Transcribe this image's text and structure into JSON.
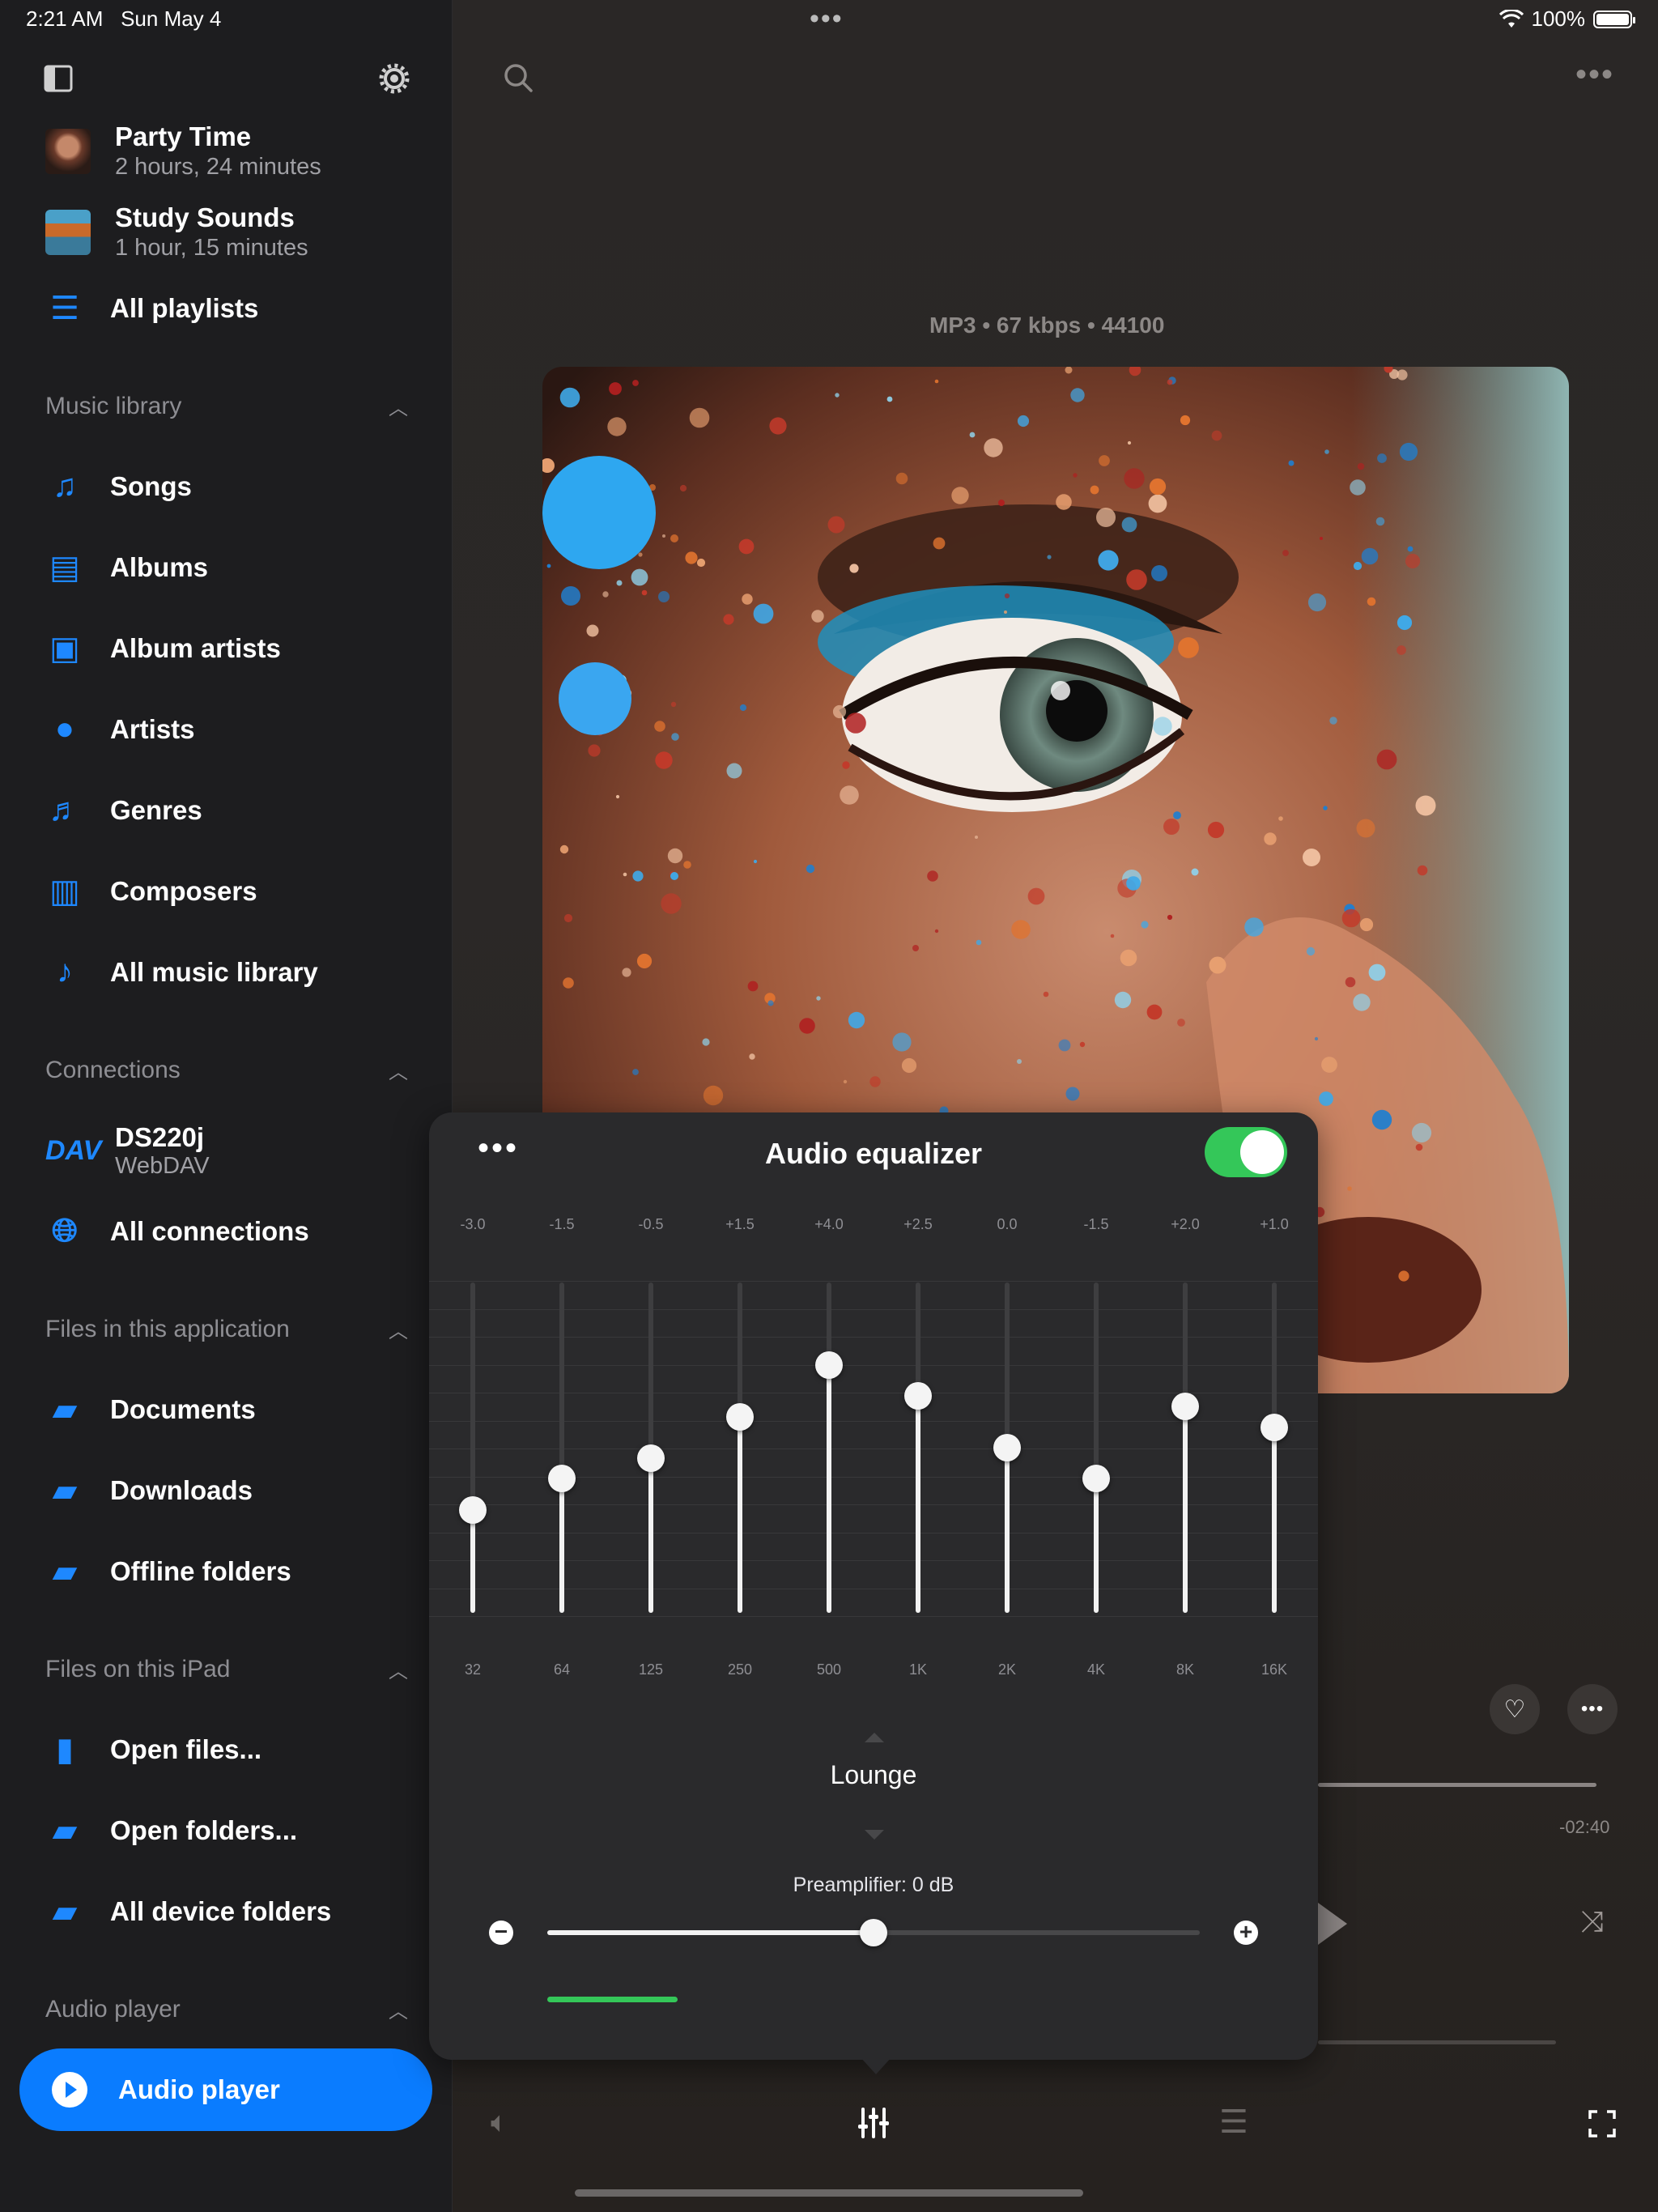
{
  "status_bar": {
    "time": "2:21 AM",
    "date": "Sun May 4",
    "battery": "100%"
  },
  "sidebar": {
    "playlists": [
      {
        "title": "Party Time",
        "subtitle": "2 hours, 24 minutes"
      },
      {
        "title": "Study Sounds",
        "subtitle": "1 hour, 15 minutes"
      }
    ],
    "all_playlists": "All playlists",
    "music_library": {
      "heading": "Music library",
      "items": [
        "Songs",
        "Albums",
        "Album artists",
        "Artists",
        "Genres",
        "Composers",
        "All music library"
      ]
    },
    "connections": {
      "heading": "Connections",
      "server": {
        "icon_label": "DAV",
        "name": "DS220j",
        "protocol": "WebDAV"
      },
      "all": "All connections"
    },
    "files_app": {
      "heading": "Files in this application",
      "items": [
        "Documents",
        "Downloads",
        "Offline folders"
      ]
    },
    "files_ipad": {
      "heading": "Files on this iPad",
      "items": [
        "Open files...",
        "Open folders...",
        "All device folders"
      ]
    },
    "audio_player": {
      "heading": "Audio player",
      "item": "Audio player"
    }
  },
  "player": {
    "format": "MP3 • 67 kbps • 44100",
    "remaining": "-02:40"
  },
  "equalizer": {
    "title": "Audio equalizer",
    "enabled": true,
    "bands": [
      {
        "freq": "32",
        "gain_label": "-3.0",
        "gain": -3.0
      },
      {
        "freq": "64",
        "gain_label": "-1.5",
        "gain": -1.5
      },
      {
        "freq": "125",
        "gain_label": "-0.5",
        "gain": -0.5
      },
      {
        "freq": "250",
        "gain_label": "+1.5",
        "gain": 1.5
      },
      {
        "freq": "500",
        "gain_label": "+4.0",
        "gain": 4.0
      },
      {
        "freq": "1K",
        "gain_label": "+2.5",
        "gain": 2.5
      },
      {
        "freq": "2K",
        "gain_label": "0.0",
        "gain": 0.0
      },
      {
        "freq": "4K",
        "gain_label": "-1.5",
        "gain": -1.5
      },
      {
        "freq": "8K",
        "gain_label": "+2.0",
        "gain": 2.0
      },
      {
        "freq": "16K",
        "gain_label": "+1.0",
        "gain": 1.0
      }
    ],
    "preset": "Lounge",
    "preamp_label": "Preamplifier: 0 dB",
    "preamp_fraction": 0.5,
    "level_fraction": 0.2
  },
  "colors": {
    "accent": "#1e88ff",
    "toggle_on": "#34c759",
    "active_item": "#0a7cff"
  }
}
